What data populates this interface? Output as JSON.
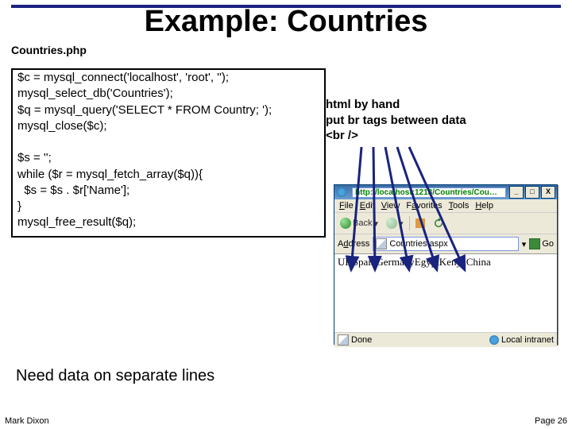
{
  "title": "Example: Countries",
  "file_label": "Countries.php",
  "code": {
    "l1": "$c = mysql_connect('localhost', 'root', '');",
    "l2": "mysql_select_db('Countries');",
    "l3": "$q = mysql_query('SELECT * FROM Country; ');",
    "l4": "mysql_close($c);",
    "l5": " ",
    "l6": "$s = '';",
    "l7": "while ($r = mysql_fetch_array($q)){",
    "l8": "  $s = $s . $r['Name'];",
    "l9": "}",
    "l10": "mysql_free_result($q);"
  },
  "annotation": {
    "l1": "html by hand",
    "l2": "put br tags between data",
    "l3": "<br />"
  },
  "need_text": "Need data on separate lines",
  "author": "Mark Dixon",
  "page": "Page 26",
  "browser": {
    "url": "http://localhost:1213/Countries/Cou…",
    "menu": {
      "file": "File",
      "edit": "Edit",
      "view": "View",
      "fav": "Favorites",
      "tools": "Tools",
      "help": "Help"
    },
    "toolbar": {
      "back": "Back"
    },
    "addr_label": "Address",
    "addr_value": "Countries.aspx",
    "go_label": "Go",
    "content": "UKSpainGermanyEgyptKenyaChina",
    "status_left": "Done",
    "status_right": "Local intranet",
    "winbtn_min": "_",
    "winbtn_max": "□",
    "winbtn_close": "X"
  }
}
